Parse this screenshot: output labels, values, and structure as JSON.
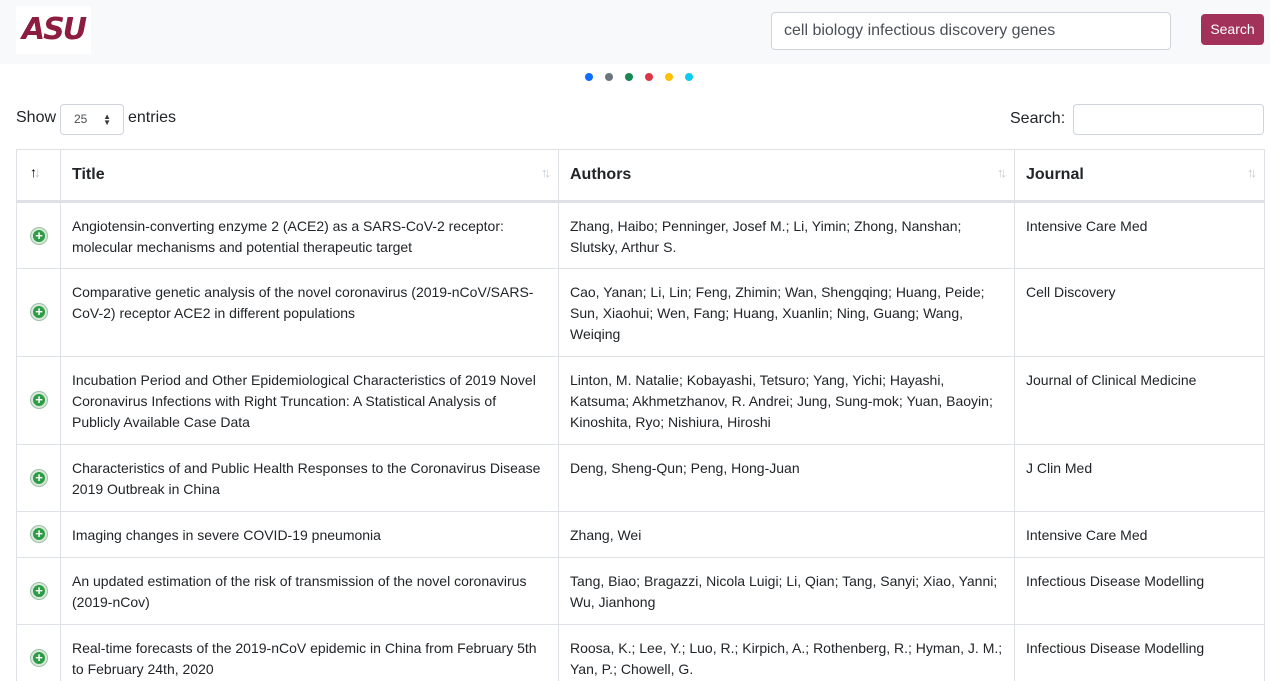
{
  "header": {
    "logo_text": "ASU",
    "search_value": "cell biology infectious discovery genes",
    "search_button": "Search"
  },
  "loading_dots": [
    "#0d6efd",
    "#6c757d",
    "#198754",
    "#dc3545",
    "#ffc107",
    "#0dcaf0"
  ],
  "controls": {
    "show_label": "Show",
    "entries_value": "25",
    "entries_label": "entries",
    "search_label": "Search:"
  },
  "table": {
    "columns": [
      "Title",
      "Authors",
      "Journal"
    ],
    "rows": [
      {
        "title": "Angiotensin-converting enzyme 2 (ACE2) as a SARS-CoV-2 receptor: molecular mechanisms and potential therapeutic target",
        "authors": "Zhang, Haibo; Penninger, Josef M.; Li, Yimin; Zhong, Nanshan; Slutsky, Arthur S.",
        "journal": "Intensive Care Med"
      },
      {
        "title": "Comparative genetic analysis of the novel coronavirus (2019-nCoV/SARS-CoV-2) receptor ACE2 in different populations",
        "authors": "Cao, Yanan; Li, Lin; Feng, Zhimin; Wan, Shengqing; Huang, Peide; Sun, Xiaohui; Wen, Fang; Huang, Xuanlin; Ning, Guang; Wang, Weiqing",
        "journal": "Cell Discovery"
      },
      {
        "title": "Incubation Period and Other Epidemiological Characteristics of 2019 Novel Coronavirus Infections with Right Truncation: A Statistical Analysis of Publicly Available Case Data",
        "authors": "Linton, M. Natalie; Kobayashi, Tetsuro; Yang, Yichi; Hayashi, Katsuma; Akhmetzhanov, R. Andrei; Jung, Sung-mok; Yuan, Baoyin; Kinoshita, Ryo; Nishiura, Hiroshi",
        "journal": "Journal of Clinical Medicine"
      },
      {
        "title": "Characteristics of and Public Health Responses to the Coronavirus Disease 2019 Outbreak in China",
        "authors": "Deng, Sheng-Qun; Peng, Hong-Juan",
        "journal": "J Clin Med"
      },
      {
        "title": "Imaging changes in severe COVID-19 pneumonia",
        "authors": "Zhang, Wei",
        "journal": "Intensive Care Med"
      },
      {
        "title": "An updated estimation of the risk of transmission of the novel coronavirus (2019-nCov)",
        "authors": "Tang, Biao; Bragazzi, Nicola Luigi; Li, Qian; Tang, Sanyi; Xiao, Yanni; Wu, Jianhong",
        "journal": "Infectious Disease Modelling"
      },
      {
        "title": "Real-time forecasts of the 2019-nCoV epidemic in China from February 5th to February 24th, 2020",
        "authors": "Roosa, K.; Lee, Y.; Luo, R.; Kirpich, A.; Rothenberg, R.; Hyman, J. M.; Yan, P.; Chowell, G.",
        "journal": "Infectious Disease Modelling"
      }
    ]
  }
}
